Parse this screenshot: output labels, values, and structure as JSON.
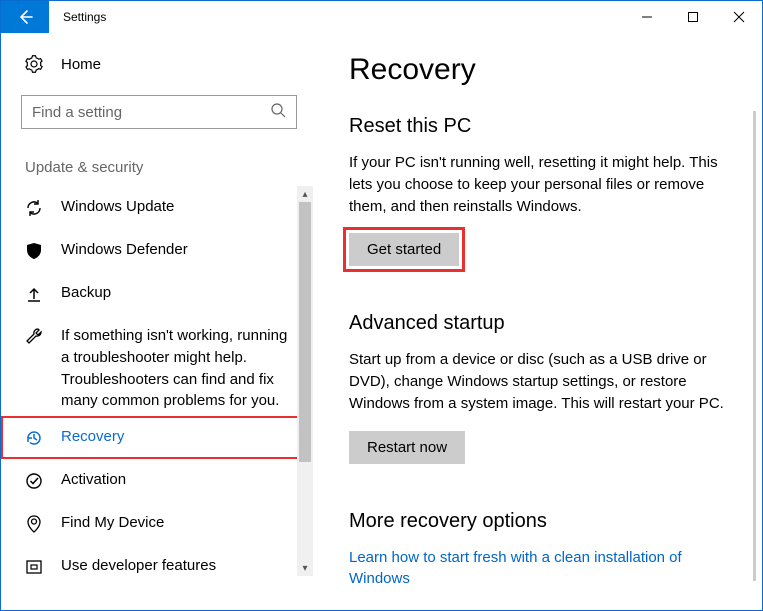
{
  "window": {
    "title": "Settings"
  },
  "sidebar": {
    "home_label": "Home",
    "search_placeholder": "Find a setting",
    "section_label": "Update & security",
    "hint_text": "If something isn't working, running a troubleshooter might help. Troubleshooters can find and fix many common problems for you.",
    "items": [
      {
        "label": "Windows Update"
      },
      {
        "label": "Windows Defender"
      },
      {
        "label": "Backup"
      },
      {
        "label": "Recovery"
      },
      {
        "label": "Activation"
      },
      {
        "label": "Find My Device"
      },
      {
        "label": "Use developer features"
      }
    ]
  },
  "main": {
    "page_title": "Recovery",
    "reset": {
      "title": "Reset this PC",
      "body": "If your PC isn't running well, resetting it might help. This lets you choose to keep your personal files or remove them, and then reinstalls Windows.",
      "button": "Get started"
    },
    "advanced": {
      "title": "Advanced startup",
      "body": "Start up from a device or disc (such as a USB drive or DVD), change Windows startup settings, or restore Windows from a system image. This will restart your PC.",
      "button": "Restart now"
    },
    "more": {
      "title": "More recovery options",
      "link": "Learn how to start fresh with a clean installation of Windows"
    }
  }
}
